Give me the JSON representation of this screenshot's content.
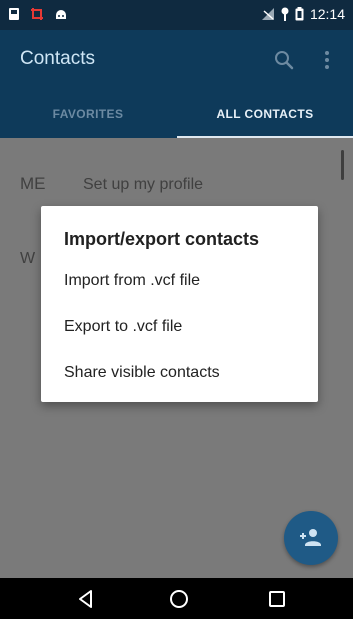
{
  "status_bar": {
    "time": "12:14",
    "left_icons": [
      "sim-card-icon",
      "screenshot-crop-icon",
      "android-icon"
    ],
    "right_icons": [
      "signal-off-icon",
      "location-key-icon",
      "battery-icon"
    ]
  },
  "app_bar": {
    "title": "Contacts",
    "icons": [
      "search-icon",
      "more-vert-icon"
    ]
  },
  "tabs": [
    {
      "label": "FAVORITES",
      "selected": false
    },
    {
      "label": "ALL CONTACTS",
      "selected": true
    }
  ],
  "contacts": {
    "me_label": "ME",
    "me_text": "Set up my profile",
    "section_letter": "W"
  },
  "dialog": {
    "title": "Import/export contacts",
    "items": [
      "Import from .vcf file",
      "Export to .vcf file",
      "Share visible contacts"
    ]
  },
  "fab": {
    "icon": "add-person-icon"
  },
  "nav_bar": {
    "buttons": [
      "back-icon",
      "home-icon",
      "recents-icon"
    ]
  },
  "colors": {
    "status_bar": "#0f2a40",
    "app_bar": "#0e3a5a",
    "overlay_bg": "#7a7a7a",
    "fab": "#1f5a86",
    "dialog_bg": "#ffffff"
  }
}
